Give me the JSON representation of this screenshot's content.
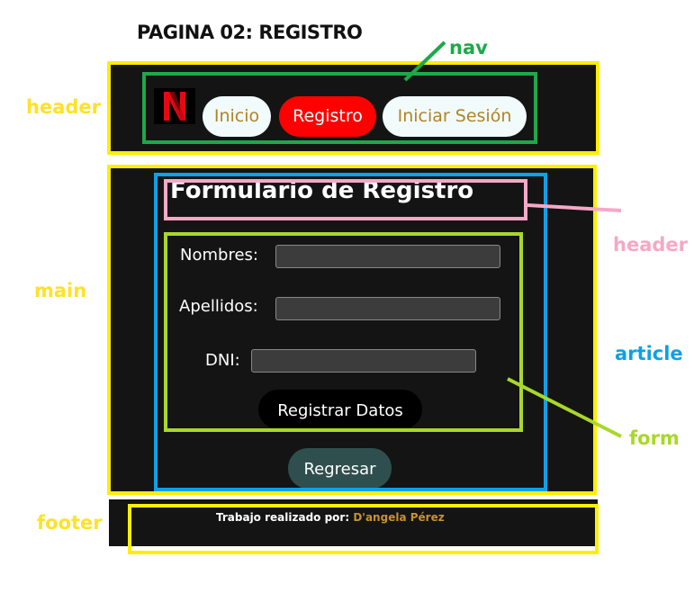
{
  "page_title": "PAGINA 02: REGISTRO",
  "annotations": {
    "header": "header",
    "main": "main",
    "footer": "footer",
    "nav": "nav",
    "inner_header": "header",
    "article": "article",
    "form": "form"
  },
  "nav": {
    "logo_letter": "N",
    "items": [
      {
        "label": "Inicio",
        "active": false
      },
      {
        "label": "Registro",
        "active": true
      },
      {
        "label": "Iniciar Sesión",
        "active": false
      }
    ]
  },
  "form": {
    "heading": "Formulario de Registro",
    "fields": [
      {
        "label": "Nombres:",
        "value": ""
      },
      {
        "label": "Apellidos:",
        "value": ""
      },
      {
        "label": "DNI:",
        "value": ""
      }
    ],
    "submit_label": "Registrar Datos"
  },
  "back_button": "Regresar",
  "footer": {
    "prefix": "Trabajo realizado por:",
    "author": "D'angela Pérez"
  },
  "colors": {
    "header_box": "#ffee00",
    "nav_box": "#1ea84a",
    "article_box": "#0fa0e6",
    "inner_header_box": "#f6a8c6",
    "form_box": "#a8d82a",
    "panel_bg": "#141414",
    "active_nav": "#ff0000",
    "logo_red": "#e50914"
  }
}
